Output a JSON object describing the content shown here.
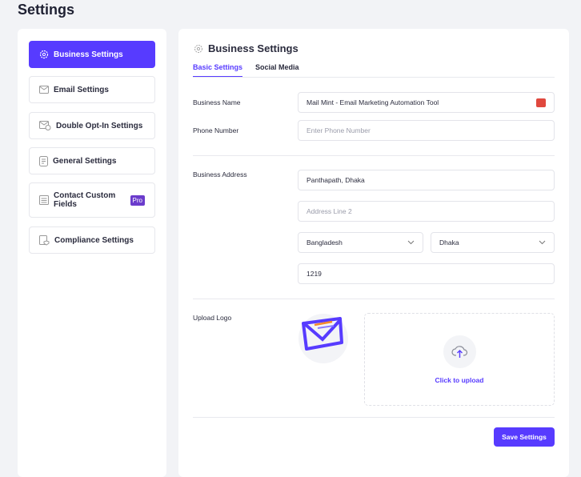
{
  "page": {
    "title": "Settings"
  },
  "sidebar": {
    "items": [
      {
        "label": "Business Settings",
        "icon": "gear-icon",
        "active": true
      },
      {
        "label": "Email Settings",
        "icon": "envelope-icon"
      },
      {
        "label": "Double Opt-In Settings",
        "icon": "envelope-check-icon"
      },
      {
        "label": "General Settings",
        "icon": "document-icon"
      },
      {
        "label": "Contact Custom Fields",
        "icon": "form-icon",
        "badge": "Pro"
      },
      {
        "label": "Compliance Settings",
        "icon": "document-shield-icon"
      }
    ]
  },
  "main": {
    "title": "Business Settings",
    "tabs": [
      {
        "label": "Basic Settings",
        "active": true
      },
      {
        "label": "Social Media"
      }
    ],
    "business_name": {
      "label": "Business Name",
      "value": "Mail Mint - Email Marketing Automation Tool"
    },
    "phone": {
      "label": "Phone Number",
      "placeholder": "Enter Phone Number"
    },
    "address": {
      "label": "Business Address",
      "line1": "Panthapath, Dhaka",
      "line2_placeholder": "Address Line 2",
      "country": "Bangladesh",
      "city": "Dhaka",
      "zip": "1219"
    },
    "logo": {
      "label": "Upload Logo",
      "upload_text": "Click to upload"
    },
    "save_label": "Save Settings"
  },
  "colors": {
    "accent": "#573bff",
    "pro_badge": "#6b3ccc"
  }
}
